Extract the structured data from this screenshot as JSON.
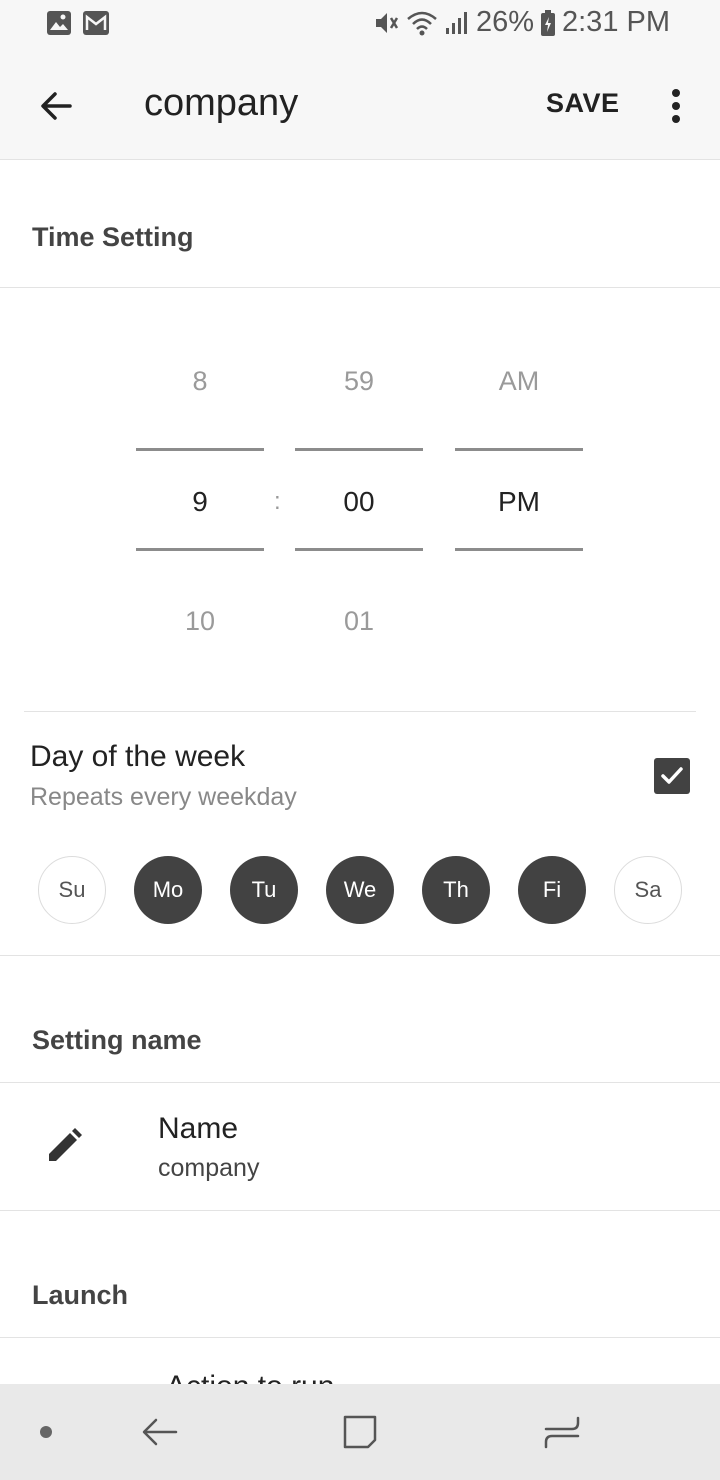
{
  "status_bar": {
    "battery_percent": "26%",
    "time": "2:31 PM",
    "icons": [
      "image-icon",
      "gmail-icon",
      "mute-icon",
      "wifi-icon",
      "signal-icon",
      "battery-charging-icon"
    ]
  },
  "app_bar": {
    "title": "company",
    "save_label": "SAVE"
  },
  "time_setting": {
    "header": "Time Setting",
    "hour": {
      "prev": "8",
      "value": "9",
      "next": "10"
    },
    "separator": ":",
    "minute": {
      "prev": "59",
      "value": "00",
      "next": "01"
    },
    "meridiem": {
      "prev": "AM",
      "value": "PM"
    }
  },
  "day_of_week": {
    "title": "Day of the week",
    "subtitle": "Repeats every weekday",
    "checked": true,
    "days": [
      {
        "label": "Su",
        "selected": false
      },
      {
        "label": "Mo",
        "selected": true
      },
      {
        "label": "Tu",
        "selected": true
      },
      {
        "label": "We",
        "selected": true
      },
      {
        "label": "Th",
        "selected": true
      },
      {
        "label": "Fi",
        "selected": true
      },
      {
        "label": "Sa",
        "selected": false
      }
    ]
  },
  "setting_name": {
    "header": "Setting name",
    "label": "Name",
    "value": "company"
  },
  "launch": {
    "header": "Launch",
    "clipped_item": "Action to run"
  },
  "colors": {
    "selected_day": "#424242",
    "background": "#ffffff",
    "app_bar": "#f7f7f7"
  }
}
